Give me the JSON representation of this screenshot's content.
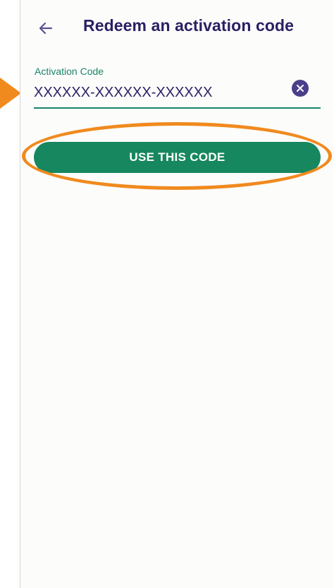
{
  "header": {
    "title": "Redeem an activation code",
    "back_icon": "arrow-left-icon"
  },
  "activation_field": {
    "label": "Activation Code",
    "value": "XXXXXX-XXXXXX-XXXXXX",
    "clear_icon": "clear-circle-icon"
  },
  "actions": {
    "use_code_label": "USE THIS CODE"
  },
  "annotations": {
    "arrow_icon": "pointer-arrow-icon",
    "ellipse": "highlight-ellipse"
  },
  "colors": {
    "title": "#2a1f63",
    "accent_green": "#1a8466",
    "button_green": "#16875f",
    "icon_purple": "#4b3e8a",
    "annotation_orange": "#f08a1e"
  }
}
